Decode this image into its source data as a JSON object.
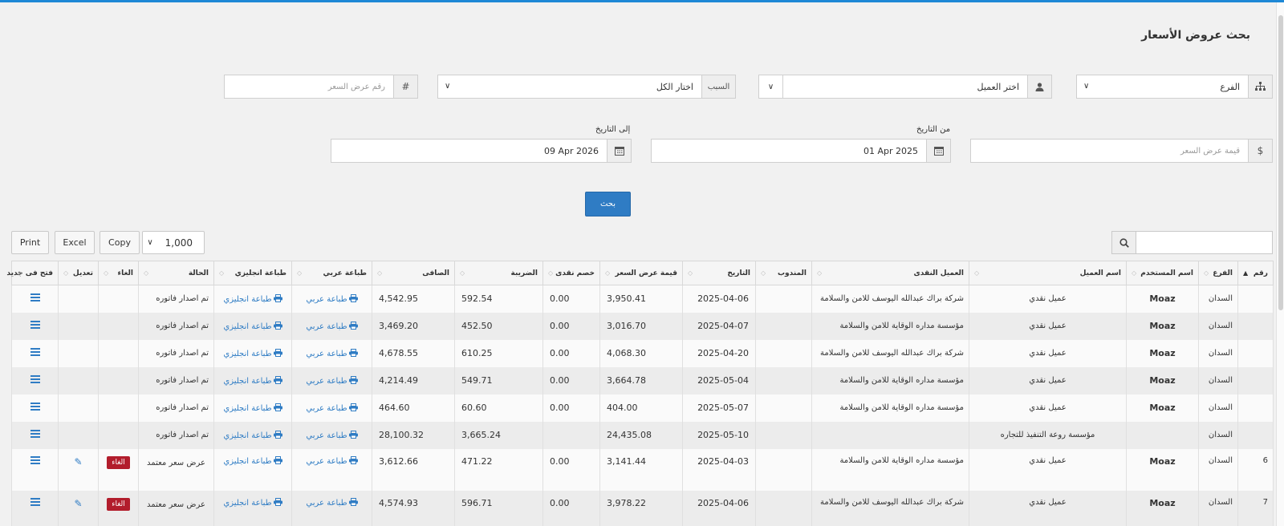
{
  "page": {
    "title": "بحث عروض الأسعار"
  },
  "filters": {
    "branch_placeholder": "الفرع",
    "customer_placeholder": "اختر العميل",
    "reason_label": "السبب",
    "reason_value": "اختار الكل",
    "quote_number_placeholder": "رقم عرض السعر",
    "quote_number_addon": "#",
    "quote_value_placeholder": "قيمة عرض السعر",
    "quote_value_addon": "$",
    "from_date_label": "من التاريخ",
    "from_date_value": "01 Apr 2025",
    "to_date_label": "إلى التاريخ",
    "to_date_value": "09 Apr 2026",
    "search_button": "بحث"
  },
  "toolbar": {
    "print_label": "Print",
    "excel_label": "Excel",
    "copy_label": "Copy",
    "page_length": "1,000"
  },
  "columns": [
    "رقم",
    "الفرع",
    "اسم المستخدم",
    "اسم العميل",
    "العميل النقدى",
    "المندوب",
    "التاريخ",
    "قيمة عرض السعر",
    "خصم نقدى",
    "الضريبة",
    "الصافى",
    "طباعة عربي",
    "طباعة انجليزي",
    "الحالة",
    "الغاء",
    "تعديل",
    "فتح فى جديد"
  ],
  "links": {
    "print_ar": "طباعة عربي",
    "print_en": "طباعة انجليزي",
    "cancel": "الغاء"
  },
  "rows": [
    {
      "num": "",
      "branch": "السدان",
      "user": "Moaz",
      "customer": "عميل نقدي",
      "cash_customer": "شركة براك عبدالله اليوسف للامن والسلامة",
      "rep": "",
      "date": "2025-04-06",
      "value": "3,950.41",
      "discount": "0.00",
      "tax": "592.54",
      "net": "4,542.95",
      "status": "تم اصدار فاتوره",
      "cancel": false,
      "edit": false
    },
    {
      "num": "",
      "branch": "السدان",
      "user": "Moaz",
      "customer": "عميل نقدي",
      "cash_customer": "مؤسسة مداره الوقاية للامن والسلامة",
      "rep": "",
      "date": "2025-04-07",
      "value": "3,016.70",
      "discount": "0.00",
      "tax": "452.50",
      "net": "3,469.20",
      "status": "تم اصدار فاتوره",
      "cancel": false,
      "edit": false
    },
    {
      "num": "",
      "branch": "السدان",
      "user": "Moaz",
      "customer": "عميل نقدي",
      "cash_customer": "شركة براك عبدالله اليوسف للامن والسلامة",
      "rep": "",
      "date": "2025-04-20",
      "value": "4,068.30",
      "discount": "0.00",
      "tax": "610.25",
      "net": "4,678.55",
      "status": "تم اصدار فاتوره",
      "cancel": false,
      "edit": false
    },
    {
      "num": "",
      "branch": "السدان",
      "user": "Moaz",
      "customer": "عميل نقدي",
      "cash_customer": "مؤسسة مداره الوقاية للامن والسلامة",
      "rep": "",
      "date": "2025-05-04",
      "value": "3,664.78",
      "discount": "0.00",
      "tax": "549.71",
      "net": "4,214.49",
      "status": "تم اصدار فاتوره",
      "cancel": false,
      "edit": false
    },
    {
      "num": "",
      "branch": "السدان",
      "user": "Moaz",
      "customer": "عميل نقدي",
      "cash_customer": "مؤسسة مداره الوقاية للامن والسلامة",
      "rep": "",
      "date": "2025-05-07",
      "value": "404.00",
      "discount": "0.00",
      "tax": "60.60",
      "net": "464.60",
      "status": "تم اصدار فاتوره",
      "cancel": false,
      "edit": false
    },
    {
      "num": "",
      "branch": "السدان",
      "user": "",
      "customer": "مؤسسة روعة التنفيذ للتجاره",
      "cash_customer": "",
      "rep": "",
      "date": "2025-05-10",
      "value": "24,435.08",
      "discount": "",
      "tax": "3,665.24",
      "net": "28,100.32",
      "status": "تم اصدار فاتوره",
      "cancel": false,
      "edit": false
    },
    {
      "num": "6",
      "branch": "السدان",
      "user": "Moaz",
      "customer": "عميل نقدي",
      "cash_customer": "مؤسسة مداره الوقاية للامن والسلامة",
      "rep": "",
      "date": "2025-04-03",
      "value": "3,141.44",
      "discount": "0.00",
      "tax": "471.22",
      "net": "3,612.66",
      "status": "عرض سعر معتمد",
      "cancel": true,
      "edit": true
    },
    {
      "num": "7",
      "branch": "السدان",
      "user": "Moaz",
      "customer": "عميل نقدي",
      "cash_customer": "شركة براك عبدالله اليوسف للامن والسلامة",
      "rep": "",
      "date": "2025-04-06",
      "value": "3,978.22",
      "discount": "0.00",
      "tax": "596.71",
      "net": "4,574.93",
      "status": "عرض سعر معتمد",
      "cancel": true,
      "edit": true
    }
  ]
}
